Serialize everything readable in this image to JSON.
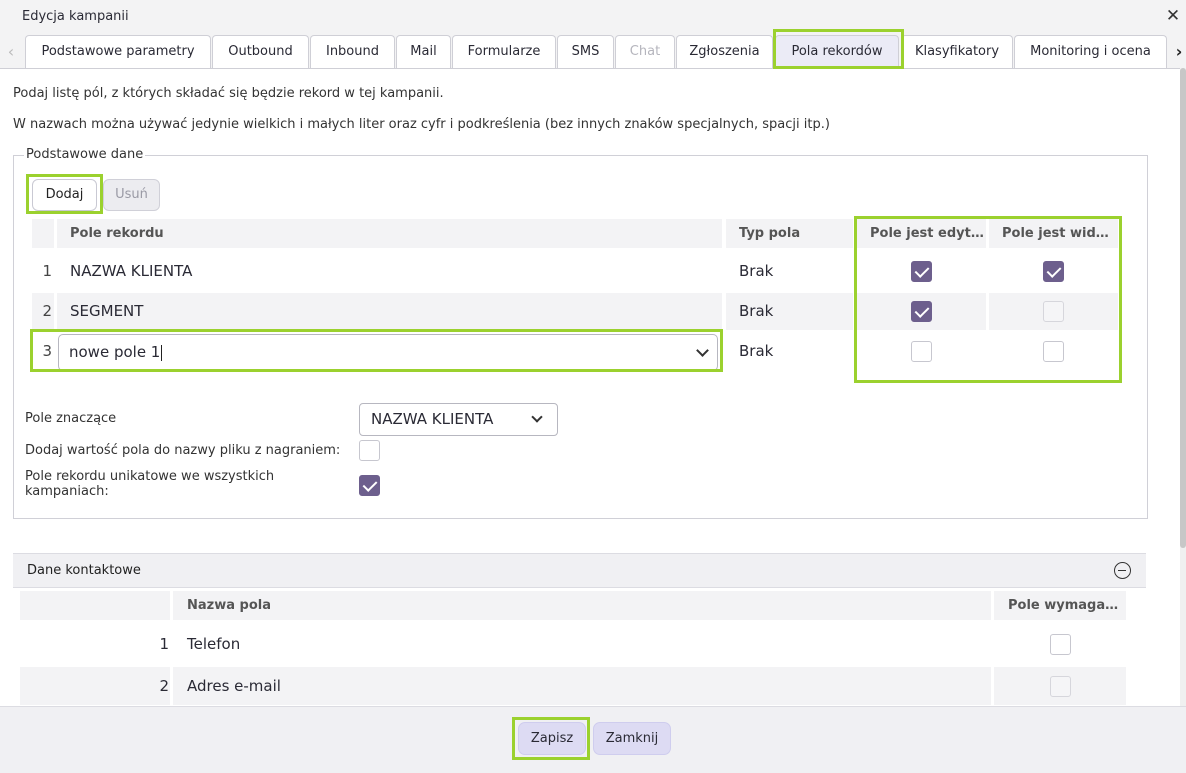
{
  "window": {
    "title": "Edycja kampanii"
  },
  "tabs": [
    {
      "label": "Podstawowe parametry"
    },
    {
      "label": "Outbound"
    },
    {
      "label": "Inbound"
    },
    {
      "label": "Mail"
    },
    {
      "label": "Formularze"
    },
    {
      "label": "SMS"
    },
    {
      "label": "Chat",
      "disabled": true
    },
    {
      "label": "Zgłoszenia"
    },
    {
      "label": "Pola rekordów",
      "active": true
    },
    {
      "label": "Klasyfikatory"
    },
    {
      "label": "Monitoring i ocena"
    }
  ],
  "info": {
    "line1": "Podaj listę pól, z których składać się będzie rekord w tej kampanii.",
    "line2": "W nazwach można używać jedynie wielkich i małych liter oraz cyfr i podkreślenia (bez innych znaków specjalnych, spacji itp.)"
  },
  "basic": {
    "legend": "Podstawowe dane",
    "add_label": "Dodaj",
    "remove_label": "Usuń",
    "columns": [
      "Pole rekordu",
      "Typ pola",
      "Pole jest edyt…",
      "Pole jest wid…"
    ],
    "rows": [
      {
        "num": "1",
        "field": "NAZWA KLIENTA",
        "type": "Brak",
        "editable": true,
        "visible": true
      },
      {
        "num": "2",
        "field": "SEGMENT",
        "type": "Brak",
        "editable": true,
        "visible": false
      },
      {
        "num": "3",
        "field": "nowe pole 1",
        "type": "Brak",
        "editable": false,
        "visible": false
      }
    ],
    "significant_label": "Pole znaczące",
    "significant_value": "NAZWA KLIENTA",
    "filename_label": "Dodaj wartość pola do nazwy pliku z nagraniem:",
    "filename_checked": false,
    "unique_label_1": "Pole rekordu unikatowe we wszystkich",
    "unique_label_2": "kampaniach:",
    "unique_checked": true
  },
  "contact": {
    "title": "Dane kontaktowe",
    "columns": [
      "Nazwa pola",
      "Pole wymaga…"
    ],
    "rows": [
      {
        "num": "1",
        "name": "Telefon",
        "required": false
      },
      {
        "num": "2",
        "name": "Adres e-mail",
        "required": false
      }
    ]
  },
  "footer": {
    "save_label": "Zapisz",
    "close_label": "Zamknij"
  },
  "colors": {
    "accent": "#6d5f8d",
    "highlight": "#9bd12e",
    "button": "#dddbf3"
  }
}
